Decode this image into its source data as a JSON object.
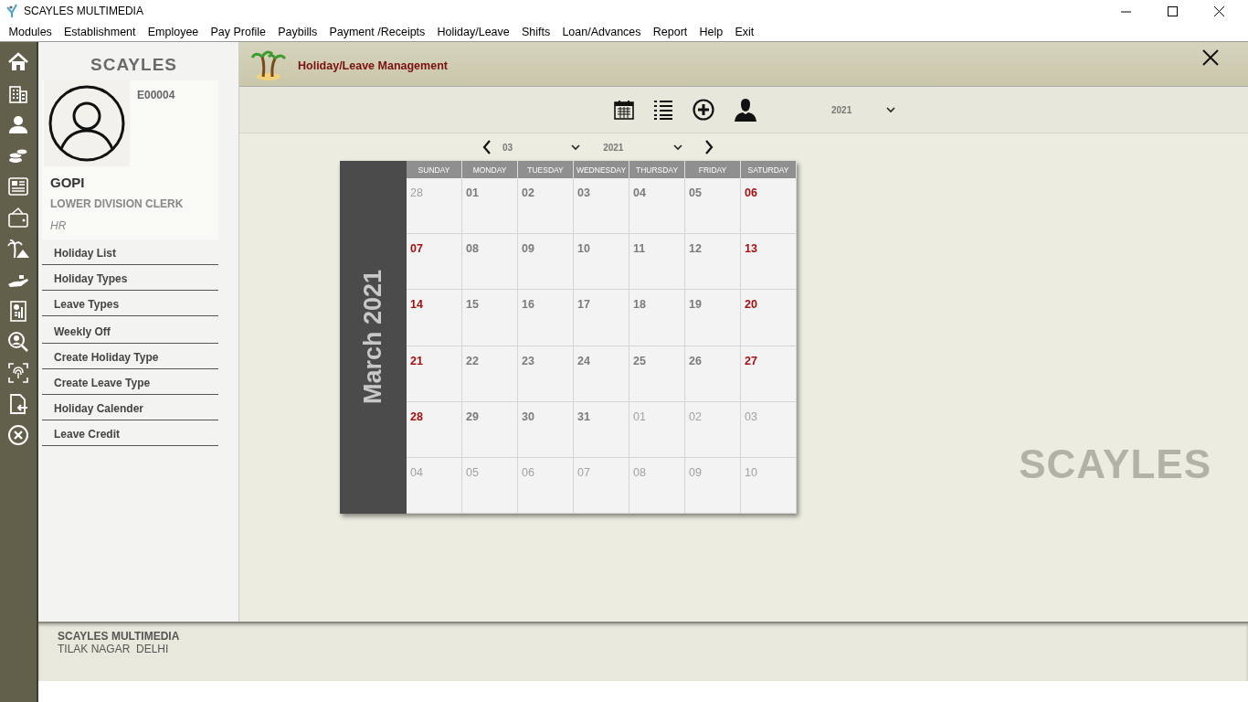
{
  "window": {
    "title": "SCAYLES MULTIMEDIA"
  },
  "menu": [
    "Modules",
    "Establishment",
    "Employee",
    "Pay Profile",
    "Paybills",
    "Payment /Receipts",
    "Holiday/Leave",
    "Shifts",
    "Loan/Advances",
    "Report",
    "Help",
    "Exit"
  ],
  "profile": {
    "logo": "SCAYLES",
    "employee_id": "E00004",
    "name": "GOPI",
    "designation": "LOWER DIVISION CLERK",
    "department": "HR"
  },
  "sidebar": {
    "items": [
      "Holiday List",
      "Holiday Types",
      "Leave Types",
      "Weekly Off",
      "Create Holiday Type",
      "Create Leave Type",
      "Holiday Calender",
      "Leave Credit"
    ]
  },
  "header": {
    "title": "Holiday/Leave Management"
  },
  "toolbar": {
    "year": "2021"
  },
  "navigator": {
    "month": "03",
    "year": "2021"
  },
  "calendar": {
    "title": "March 2021",
    "weekdays": [
      "SUNDAY",
      "MONDAY",
      "TUESDAY",
      "WEDNESDAY",
      "THURSDAY",
      "FRIDAY",
      "SATURDAY"
    ],
    "weeks": [
      [
        {
          "label": "28",
          "kind": "other"
        },
        {
          "label": "01",
          "kind": "day"
        },
        {
          "label": "02",
          "kind": "day"
        },
        {
          "label": "03",
          "kind": "day"
        },
        {
          "label": "04",
          "kind": "day"
        },
        {
          "label": "05",
          "kind": "day"
        },
        {
          "label": "06",
          "kind": "weekend"
        }
      ],
      [
        {
          "label": "07",
          "kind": "weekend"
        },
        {
          "label": "08",
          "kind": "day"
        },
        {
          "label": "09",
          "kind": "day"
        },
        {
          "label": "10",
          "kind": "day"
        },
        {
          "label": "11",
          "kind": "day"
        },
        {
          "label": "12",
          "kind": "day"
        },
        {
          "label": "13",
          "kind": "weekend"
        }
      ],
      [
        {
          "label": "14",
          "kind": "weekend"
        },
        {
          "label": "15",
          "kind": "day"
        },
        {
          "label": "16",
          "kind": "day"
        },
        {
          "label": "17",
          "kind": "day"
        },
        {
          "label": "18",
          "kind": "day"
        },
        {
          "label": "19",
          "kind": "day"
        },
        {
          "label": "20",
          "kind": "weekend"
        }
      ],
      [
        {
          "label": "21",
          "kind": "weekend"
        },
        {
          "label": "22",
          "kind": "day"
        },
        {
          "label": "23",
          "kind": "day"
        },
        {
          "label": "24",
          "kind": "day"
        },
        {
          "label": "25",
          "kind": "day"
        },
        {
          "label": "26",
          "kind": "day"
        },
        {
          "label": "27",
          "kind": "weekend"
        }
      ],
      [
        {
          "label": "28",
          "kind": "weekend"
        },
        {
          "label": "29",
          "kind": "day"
        },
        {
          "label": "30",
          "kind": "day"
        },
        {
          "label": "31",
          "kind": "day"
        },
        {
          "label": "01",
          "kind": "other"
        },
        {
          "label": "02",
          "kind": "other"
        },
        {
          "label": "03",
          "kind": "other"
        }
      ],
      [
        {
          "label": "04",
          "kind": "other"
        },
        {
          "label": "05",
          "kind": "other"
        },
        {
          "label": "06",
          "kind": "other"
        },
        {
          "label": "07",
          "kind": "other"
        },
        {
          "label": "08",
          "kind": "other"
        },
        {
          "label": "09",
          "kind": "other"
        },
        {
          "label": "10",
          "kind": "other"
        }
      ]
    ]
  },
  "watermark_logo": "SCAYLES",
  "footer": {
    "company": "SCAYLES MULTIMEDIA",
    "address": "TILAK NAGAR  DELHI"
  }
}
